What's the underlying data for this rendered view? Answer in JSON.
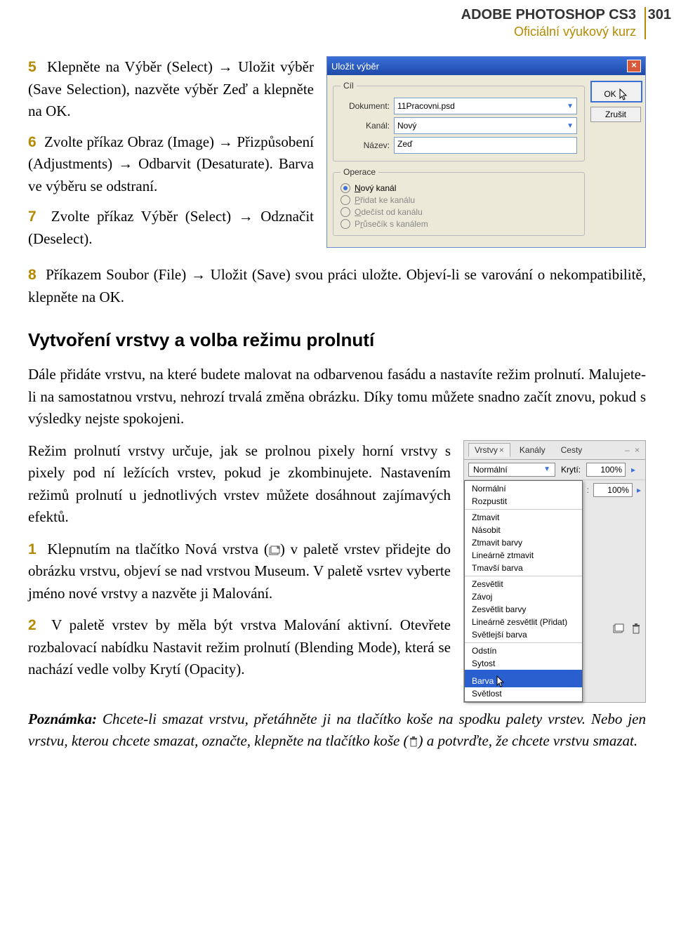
{
  "header": {
    "title": "ADOBE PHOTOSHOP CS3",
    "page_num": "301",
    "subtitle": "Oficiální výukový kurz"
  },
  "steps_a": {
    "s5": "Klepněte na Výběr (Select) → Uložit výběr (Save Selection), nazvěte výběr Zeď a klepněte na OK.",
    "s6": "Zvolte příkaz Obraz (Image) → Přizpůsobení (Adjustments) → Odbarvit (Desaturate). Barva ve výběru se odstraní.",
    "s7": "Zvolte příkaz Výběr (Select) → Odznačit (Deselect).",
    "s8": "Příkazem Soubor (File) → Uložit (Save) svou práci uložte. Objeví-li se varování o nekompatibilitě, klepněte na OK."
  },
  "dialog": {
    "title": "Uložit výběr",
    "ok": "OK",
    "cancel": "Zrušit",
    "grp_cil": "Cíl",
    "lbl_doc": "Dokument:",
    "val_doc": "11Pracovni.psd",
    "lbl_kanal": "Kanál:",
    "val_kanal": "Nový",
    "lbl_nazev": "Název:",
    "val_nazev": "Zeď",
    "grp_op": "Operace",
    "op1_u": "N",
    "op1_r": "ový kanál",
    "op2_u": "P",
    "op2_r": "řidat ke kanálu",
    "op3_u": "O",
    "op3_r": "dečíst od kanálu",
    "op4": "P",
    "op4_u": "r",
    "op4_r": "ůsečík s kanálem"
  },
  "section": {
    "heading": "Vytvoření vrstvy a volba režimu prolnutí",
    "p1": "Dále přidáte vrstvu, na které budete malovat na odbarvenou fasádu a nastavíte režim prolnutí. Malujete-li na samostatnou vrstvu, nehrozí trvalá změna obrázku. Díky tomu můžete snadno začít znovu, pokud s výsledky nejste spokojeni."
  },
  "row2text": {
    "p2": "Režim prolnutí vrstvy určuje, jak se prolnou pixely horní vrstvy s pixely pod ní ležících vrstev, pokud je zkombinujete. Nastavením režimů prolnutí u jednotlivých vrstev můžete dosáhnout zajímavých efektů.",
    "s1a": "Klepnutím na tlačítko Nová vrstva (",
    "s1b": ") v paletě vrstev přidejte do obrázku vrstvu, objeví se nad vrstvou Museum. V paletě vsrtev vyberte jméno nové vrstvy a nazvěte ji Malování.",
    "s2": "V paletě vrstev by měla být vrstva Malování aktivní. Otevřete rozbalovací nabídku Nastavit režim prolnutí (Blending Mode), která se nachází vedle volby Krytí (Opacity)."
  },
  "palette": {
    "tab_vrstvy": "Vrstvy",
    "tab_kanaly": "Kanály",
    "tab_cesty": "Cesty",
    "mode": "Normální",
    "kryti": "Krytí:",
    "pct": "100%",
    "menu": {
      "g1": [
        "Normální",
        "Rozpustit"
      ],
      "g2": [
        "Ztmavit",
        "Násobit",
        "Ztmavit barvy",
        "Lineárně ztmavit",
        "Tmavší barva"
      ],
      "g3": [
        "Zesvětlit",
        "Závoj",
        "Zesvětlit barvy",
        "Lineárně zesvětlit (Přidat)",
        "Světlejší barva"
      ],
      "g4": [
        "Odstín",
        "Sytost",
        "Barva",
        "Světlost"
      ]
    },
    "highlight": "Barva"
  },
  "note": {
    "label": "Poznámka:",
    "a": " Chcete-li smazat vrstvu, přetáhněte ji na tlačítko koše na spodku palety vrstev. Nebo jen vrstvu, kterou chcete smazat, označte, klepněte na tlačítko koše (",
    "b": ") a potvrďte, že chcete vrstvu smazat."
  }
}
